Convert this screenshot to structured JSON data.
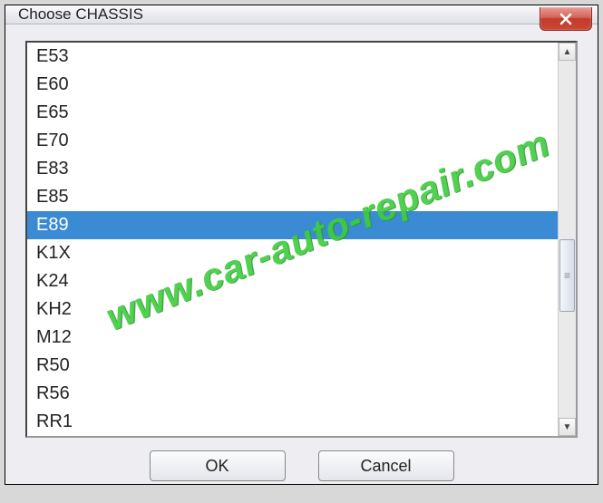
{
  "titlebar": {
    "title": "Choose CHASSIS"
  },
  "listbox": {
    "items": [
      {
        "label": "E53",
        "selected": false
      },
      {
        "label": "E60",
        "selected": false
      },
      {
        "label": "E65",
        "selected": false
      },
      {
        "label": "E70",
        "selected": false
      },
      {
        "label": "E83",
        "selected": false
      },
      {
        "label": "E85",
        "selected": false
      },
      {
        "label": "E89",
        "selected": true
      },
      {
        "label": "K1X",
        "selected": false
      },
      {
        "label": "K24",
        "selected": false
      },
      {
        "label": "KH2",
        "selected": false
      },
      {
        "label": "M12",
        "selected": false
      },
      {
        "label": "R50",
        "selected": false
      },
      {
        "label": "R56",
        "selected": false
      },
      {
        "label": "RR1",
        "selected": false
      }
    ]
  },
  "buttons": {
    "ok": "OK",
    "cancel": "Cancel"
  },
  "watermark": {
    "text": "www.car-auto-repair.com"
  }
}
